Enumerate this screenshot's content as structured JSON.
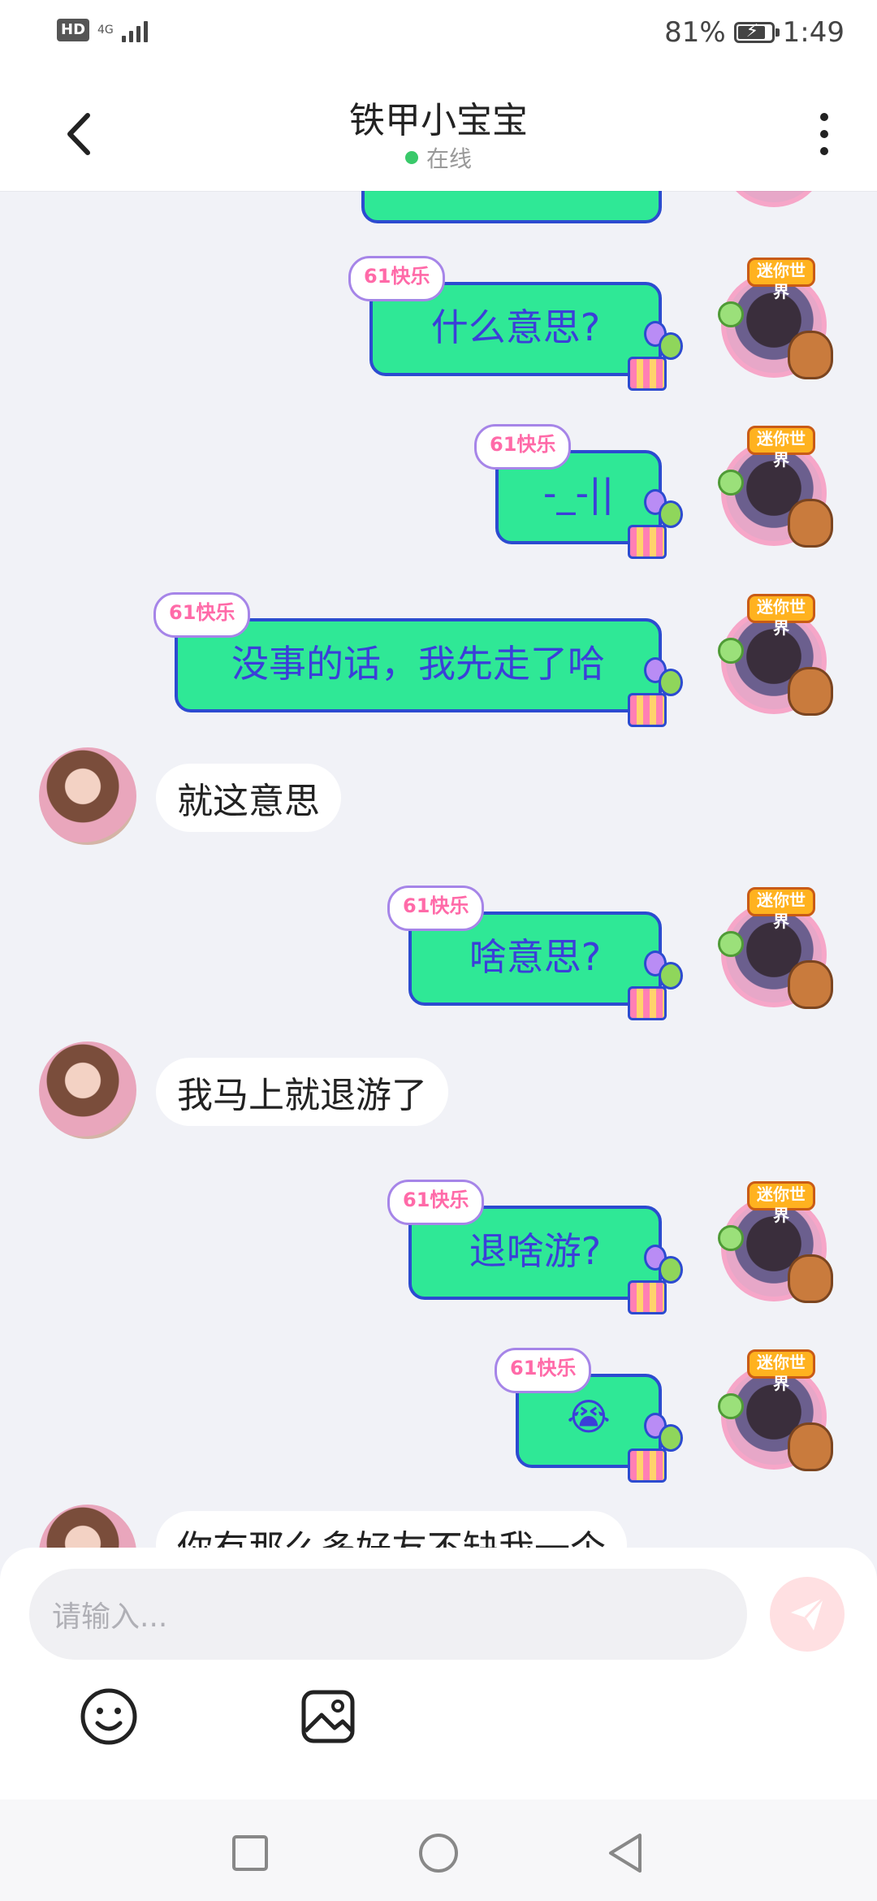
{
  "status_bar": {
    "hd": "HD",
    "network": "4G",
    "battery": "81%",
    "time": "1:49"
  },
  "header": {
    "title": "铁甲小宝宝",
    "status": "在线"
  },
  "badge": {
    "text": "61快乐",
    "avatar_crown": "迷你世界"
  },
  "messages": [
    {
      "from": "me",
      "text": "什么意思?"
    },
    {
      "from": "me",
      "text": "-_-||"
    },
    {
      "from": "me",
      "text": "没事的话，我先走了哈"
    },
    {
      "from": "her",
      "text": "就这意思"
    },
    {
      "from": "me",
      "text": "啥意思?"
    },
    {
      "from": "her",
      "text": "我马上就退游了"
    },
    {
      "from": "me",
      "text": "退啥游?"
    },
    {
      "from": "me",
      "text": "😭"
    },
    {
      "from": "her",
      "text": "你有那么多好友不缺我一个"
    }
  ],
  "composer": {
    "placeholder": "请输入..."
  },
  "colors": {
    "bubble_me": "#2fe896",
    "bubble_border": "#2c4bd0",
    "online_dot": "#39c96a",
    "send_button": "#ffe0e2"
  }
}
